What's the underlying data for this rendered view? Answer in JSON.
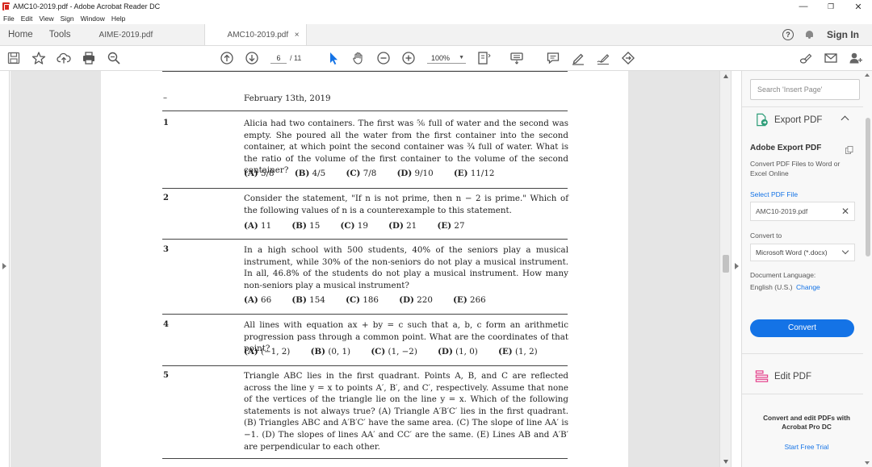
{
  "window": {
    "title": "AMC10-2019.pdf - Adobe Acrobat Reader DC",
    "controls": {
      "minimize": "—",
      "restore": "❐",
      "close": "✕"
    }
  },
  "menu": [
    "File",
    "Edit",
    "View",
    "Sign",
    "Window",
    "Help"
  ],
  "tabs": {
    "home": "Home",
    "tools": "Tools",
    "docs": [
      {
        "label": "AIME-2019.pdf"
      },
      {
        "label": "AMC10-2019.pdf",
        "close": "×"
      }
    ],
    "help": "?",
    "sign_in": "Sign In"
  },
  "toolbar": {
    "page_current": "6",
    "page_total": "/ 11",
    "zoom": "100%"
  },
  "document": {
    "dash": "–",
    "date": "February 13th, 2019",
    "questions": [
      {
        "num": "1",
        "text": "Alicia had two containers. The first was ⅚ full of water and the second was empty. She poured all the water from the first container into the second container, at which point the second container was ¾ full of water. What is the ratio of the volume of the first container to the volume of the second container?",
        "choices": [
          {
            "label": "(A)",
            "value": "5/8"
          },
          {
            "label": "(B)",
            "value": "4/5"
          },
          {
            "label": "(C)",
            "value": "7/8"
          },
          {
            "label": "(D)",
            "value": "9/10"
          },
          {
            "label": "(E)",
            "value": "11/12"
          }
        ]
      },
      {
        "num": "2",
        "text": "Consider the statement, \"If n is not prime, then n − 2 is prime.\" Which of the following values of n is a counterexample to this statement.",
        "choices": [
          {
            "label": "(A)",
            "value": "11"
          },
          {
            "label": "(B)",
            "value": "15"
          },
          {
            "label": "(C)",
            "value": "19"
          },
          {
            "label": "(D)",
            "value": "21"
          },
          {
            "label": "(E)",
            "value": "27"
          }
        ]
      },
      {
        "num": "3",
        "text": "In a high school with 500 students, 40% of the seniors play a musical instrument, while 30% of the non-seniors do not play a musical instrument. In all, 46.8% of the students do not play a musical instrument. How many non-seniors play a musical instrument?",
        "choices": [
          {
            "label": "(A)",
            "value": "66"
          },
          {
            "label": "(B)",
            "value": "154"
          },
          {
            "label": "(C)",
            "value": "186"
          },
          {
            "label": "(D)",
            "value": "220"
          },
          {
            "label": "(E)",
            "value": "266"
          }
        ]
      },
      {
        "num": "4",
        "text": "All lines with equation ax + by = c such that a, b, c form an arithmetic progression pass through a common point. What are the coordinates of that point?",
        "choices": [
          {
            "label": "(A)",
            "value": "(−1, 2)"
          },
          {
            "label": "(B)",
            "value": "(0, 1)"
          },
          {
            "label": "(C)",
            "value": "(1, −2)"
          },
          {
            "label": "(D)",
            "value": "(1, 0)"
          },
          {
            "label": "(E)",
            "value": "(1, 2)"
          }
        ]
      },
      {
        "num": "5",
        "text": "Triangle ABC lies in the first quadrant. Points A, B, and C are reflected across the line y = x to points A′, B′, and C′, respectively. Assume that none of the vertices of the triangle lie on the line y = x. Which of the following statements is not always true? (A) Triangle A′B′C′ lies in the first quadrant. (B) Triangles ABC and A′B′C′ have the same area. (C) The slope of line AA′ is −1. (D) The slopes of lines AA′ and CC′ are the same. (E) Lines AB and A′B′ are perpendicular to each other."
      }
    ]
  },
  "panel": {
    "search_placeholder": "Search 'Insert Page'",
    "export_heading": "Export PDF",
    "export_title": "Adobe Export PDF",
    "export_desc": "Convert PDF Files to Word or Excel Online",
    "select_pdf": "Select PDF File",
    "file_name": "AMC10-2019.pdf",
    "convert_to_label": "Convert to",
    "convert_to_value": "Microsoft Word (*.docx)",
    "doc_lang_label": "Document Language:",
    "doc_lang_value": "English (U.S.)",
    "change": "Change",
    "convert_button": "Convert",
    "edit_heading": "Edit PDF",
    "promo": "Convert and edit PDFs with Acrobat Pro DC",
    "trial": "Start Free Trial"
  },
  "colors": {
    "accent": "#1473e6",
    "app_red": "#d7261e",
    "export_green": "#2d9d78",
    "edit_pink": "#e4418c"
  }
}
